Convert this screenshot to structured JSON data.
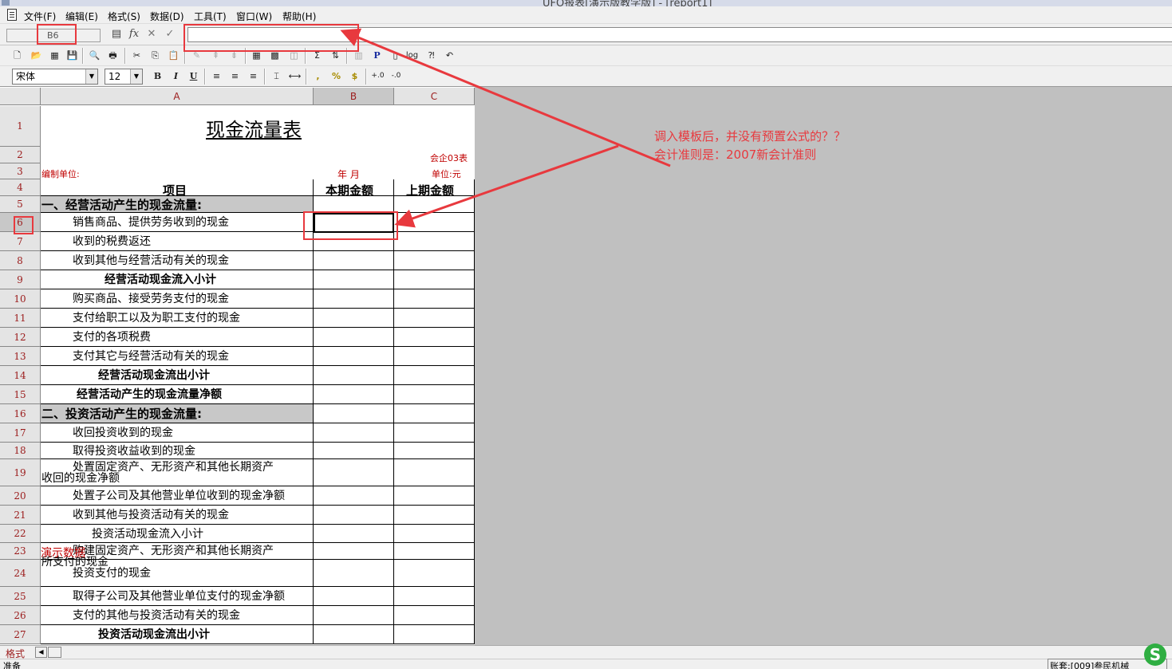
{
  "window": {
    "title": "UFO报表[演示版教学版] - [report1]"
  },
  "menu": [
    "文件(F)",
    "编辑(E)",
    "格式(S)",
    "数据(D)",
    "工具(T)",
    "窗口(W)",
    "帮助(H)"
  ],
  "formula_bar": {
    "cell_ref": "B6",
    "formula": ""
  },
  "font": {
    "name": "宋体",
    "size": "12"
  },
  "toolbar_labels": {
    "bold": "B",
    "italic": "I",
    "underline": "U",
    "comma": ",",
    "percent": "%",
    "currency": "$",
    "inc_decimal": "+.0",
    "dec_decimal": "-.0",
    "p": "P",
    "log": "log"
  },
  "columns": [
    {
      "label": "A"
    },
    {
      "label": "B"
    },
    {
      "label": "C"
    }
  ],
  "sheet": {
    "title": "现金流量表",
    "form_no": "会企03表",
    "unit_label": "编制单位:",
    "period": "年    月",
    "currency_unit": "单位:元",
    "col_item": "项目",
    "col_current": "本期金额",
    "col_prior": "上期金额",
    "watermark": "演示数据"
  },
  "rows": [
    {
      "num": "1"
    },
    {
      "num": "2"
    },
    {
      "num": "3"
    },
    {
      "num": "4"
    },
    {
      "num": "5",
      "text": "一、经营活动产生的现金流量:"
    },
    {
      "num": "6",
      "text": "销售商品、提供劳务收到的现金"
    },
    {
      "num": "7",
      "text": "收到的税费返还"
    },
    {
      "num": "8",
      "text": "收到其他与经营活动有关的现金"
    },
    {
      "num": "9",
      "text": "经营活动现金流入小计"
    },
    {
      "num": "10",
      "text": "购买商品、接受劳务支付的现金"
    },
    {
      "num": "11",
      "text": "支付给职工以及为职工支付的现金"
    },
    {
      "num": "12",
      "text": "支付的各项税费"
    },
    {
      "num": "13",
      "text": "支付其它与经营活动有关的现金"
    },
    {
      "num": "14",
      "text": "经营活动现金流出小计"
    },
    {
      "num": "15",
      "text": "经营活动产生的现金流量净额"
    },
    {
      "num": "16",
      "text": "二、投资活动产生的现金流量:"
    },
    {
      "num": "17",
      "text": "收回投资收到的现金"
    },
    {
      "num": "18",
      "text": "取得投资收益收到的现金"
    },
    {
      "num": "19",
      "text": "处置固定资产、无形资产和其他长期资产",
      "text2": "收回的现金净额"
    },
    {
      "num": "20",
      "text": "处置子公司及其他营业单位收到的现金净额"
    },
    {
      "num": "21",
      "text": "收到其他与投资活动有关的现金"
    },
    {
      "num": "22",
      "text": "投资活动现金流入小计"
    },
    {
      "num": "23",
      "text": "购建固定资产、无形资产和其他长期资产",
      "text2": "所支付的现金"
    },
    {
      "num": "24",
      "text": "投资支付的现金"
    },
    {
      "num": "25",
      "text": "取得子公司及其他营业单位支付的现金净额"
    },
    {
      "num": "26",
      "text": "支付的其他与投资活动有关的现金"
    },
    {
      "num": "27",
      "text": "投资活动现金流出小计"
    }
  ],
  "sheet_tab": "格式",
  "status": {
    "left": "准备",
    "right": "账套:[009]叁民机械"
  },
  "annotation": {
    "line1": "调入模板后，并没有预置公式的？？",
    "line2": "会计准则是：2007新会计准则"
  },
  "colors": {
    "annotation": "#e8393e",
    "header_text": "#9b1b1b"
  }
}
